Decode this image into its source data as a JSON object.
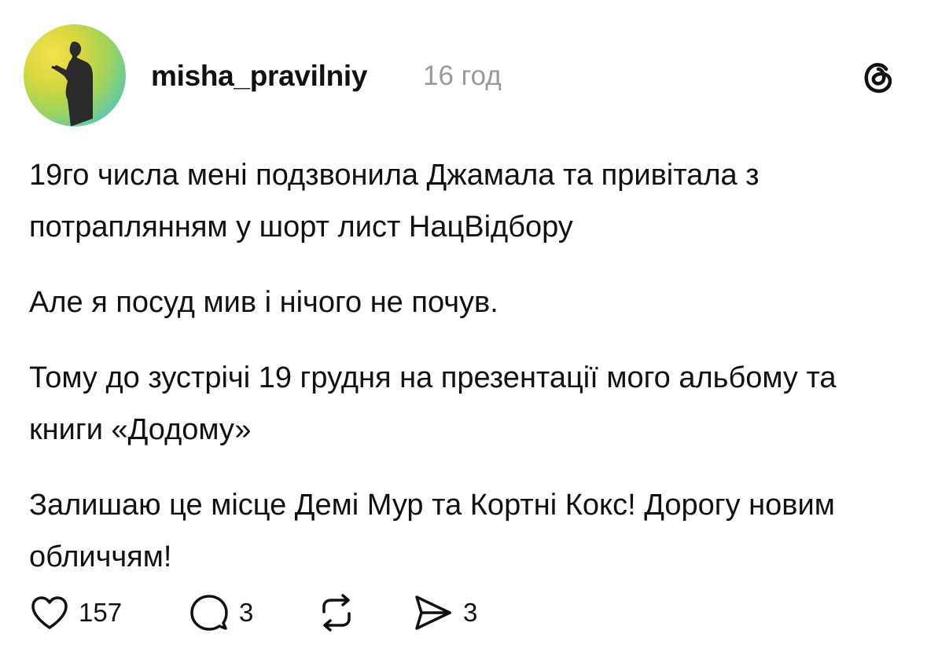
{
  "post": {
    "username": "misha_pravilniy",
    "time": "16 год",
    "paragraphs": [
      "19го числа мені подзвонила Джамала та привітала з потраплянням у шорт лист НацВідбору",
      "Але я посуд мив і нічого не почув.",
      "Тому до зустрічі 19 грудня на презентації мого альбому та книги «Додому»",
      "Залишаю це місце Демі Мур та Кортні Кокс! Дорогу новим обличчям!"
    ]
  },
  "actions": {
    "likes": "157",
    "replies": "3",
    "shares": "3"
  },
  "icons": {
    "avatar": "avatar",
    "threads": "threads-logo-icon",
    "like": "heart-icon",
    "reply": "comment-bubble-icon",
    "repost": "repost-icon",
    "share": "send-icon"
  },
  "colors": {
    "text": "#111111",
    "muted": "#9a9a9a",
    "background": "#ffffff"
  }
}
